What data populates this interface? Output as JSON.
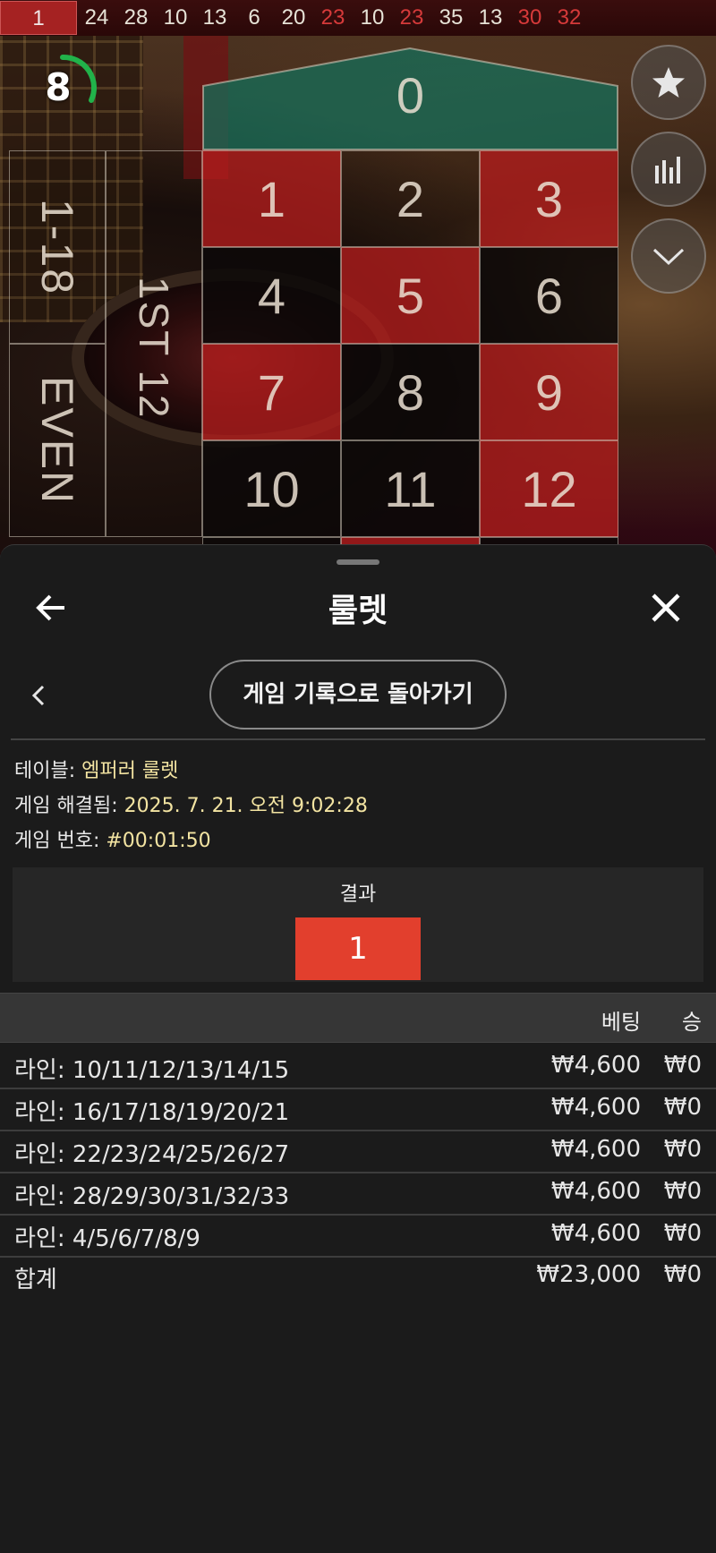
{
  "history": {
    "numbers": [
      {
        "value": "1",
        "color": "red"
      },
      {
        "value": "24",
        "color": "black"
      },
      {
        "value": "28",
        "color": "black"
      },
      {
        "value": "10",
        "color": "black"
      },
      {
        "value": "13",
        "color": "black"
      },
      {
        "value": "6",
        "color": "black"
      },
      {
        "value": "20",
        "color": "black"
      },
      {
        "value": "23",
        "color": "red"
      },
      {
        "value": "10",
        "color": "black"
      },
      {
        "value": "23",
        "color": "red"
      },
      {
        "value": "35",
        "color": "black"
      },
      {
        "value": "13",
        "color": "black"
      },
      {
        "value": "30",
        "color": "red"
      },
      {
        "value": "32",
        "color": "red"
      }
    ]
  },
  "timer": {
    "value": "8",
    "progress": 0.3
  },
  "table": {
    "zero": "0",
    "low_bet": "1-18",
    "even_bet": "EVEN",
    "dozen_bet": "1ST 12",
    "rows": [
      [
        {
          "n": "1",
          "c": "red"
        },
        {
          "n": "2",
          "c": "clear"
        },
        {
          "n": "3",
          "c": "red"
        }
      ],
      [
        {
          "n": "4",
          "c": "black"
        },
        {
          "n": "5",
          "c": "red"
        },
        {
          "n": "6",
          "c": "black"
        }
      ],
      [
        {
          "n": "7",
          "c": "red"
        },
        {
          "n": "8",
          "c": "black"
        },
        {
          "n": "9",
          "c": "red"
        }
      ],
      [
        {
          "n": "10",
          "c": "black"
        },
        {
          "n": "11",
          "c": "black"
        },
        {
          "n": "12",
          "c": "red"
        }
      ]
    ]
  },
  "side_buttons": [
    "star-icon",
    "stats-icon",
    "chevron-down-icon"
  ],
  "sheet": {
    "title": "룰렛",
    "back_to_history": "게임 기록으로 돌아가기",
    "info": {
      "table_label": "테이블: ",
      "table_value": "엠퍼러 룰렛",
      "resolved_label": "게임 해결됨: ",
      "resolved_value": "2025. 7. 21. 오전 9:02:28",
      "game_no_label": "게임 번호: ",
      "game_no_value": "#00:01:50"
    },
    "result": {
      "title": "결과",
      "number": "1",
      "color": "#e23f2d"
    },
    "columns": {
      "bet": "베팅",
      "win": "승"
    },
    "bets": [
      {
        "name": "라인: 10/11/12/13/14/15",
        "bet": "₩4,600",
        "win": "₩0"
      },
      {
        "name": "라인: 16/17/18/19/20/21",
        "bet": "₩4,600",
        "win": "₩0"
      },
      {
        "name": "라인: 22/23/24/25/26/27",
        "bet": "₩4,600",
        "win": "₩0"
      },
      {
        "name": "라인: 28/29/30/31/32/33",
        "bet": "₩4,600",
        "win": "₩0"
      },
      {
        "name": "라인: 4/5/6/7/8/9",
        "bet": "₩4,600",
        "win": "₩0"
      }
    ],
    "total": {
      "label": "합계",
      "bet": "₩23,000",
      "win": "₩0"
    }
  }
}
